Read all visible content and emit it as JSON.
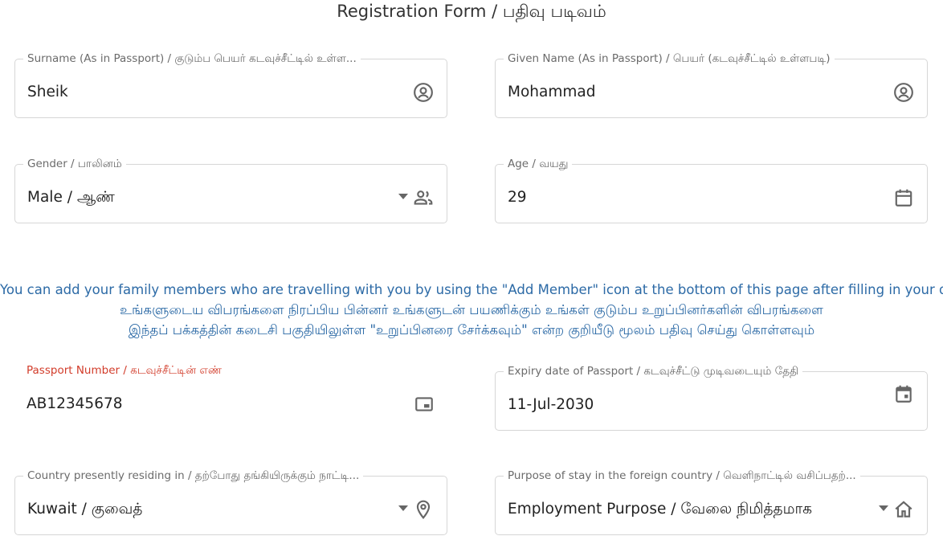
{
  "form": {
    "title": "Registration Form / பதிவு படிவம்"
  },
  "fields": {
    "surname": {
      "label": "Surname (As in Passport) / குடும்ப பெயர் கடவுச்சீட்டில் உள்ள...",
      "value": "Sheik",
      "icon": "account-circle-icon"
    },
    "given_name": {
      "label": "Given Name (As in Passport) / பெயர் (கடவுச்சீட்டில் உள்ளபடி)",
      "value": "Mohammad",
      "icon": "account-circle-icon"
    },
    "gender": {
      "label": "Gender / பாலினம்",
      "value": "Male / ஆண்",
      "icon": "people-icon"
    },
    "age": {
      "label": "Age / வயது",
      "value": "29",
      "icon": "calendar-icon"
    },
    "passport_number": {
      "label": "Passport Number / கடவுச்சீட்டின் எண்",
      "value": "AB12345678",
      "icon": "id-card-icon",
      "label_color": "#d23c2a"
    },
    "expiry_date": {
      "label": "Expiry date of Passport / கடவுச்சீட்டு முடிவடையும் தேதி",
      "value": "11-Jul-2030",
      "icon": "event-icon"
    },
    "country": {
      "label": "Country presently residing in / தற்போது தங்கியிருக்கும் நாட்டி...",
      "value": "Kuwait / குவைத்",
      "icon": "location-pin-icon"
    },
    "purpose": {
      "label": "Purpose of stay in the foreign country / வெளிநாட்டில் வசிப்பதற்...",
      "value": "Employment Purpose / வேலை நிமித்தமாக",
      "icon": "home-icon"
    }
  },
  "notice": {
    "line1": "You can add your family members who are travelling with you by using the \"Add Member\" icon at the bottom of this page after filling in your details.",
    "line2": "உங்களுடைய விபரங்களை நிரப்பிய பின்னர் உங்களுடன் பயணிக்கும் உங்கள் குடும்ப உறுப்பினர்களின் விபரங்களை",
    "line3": "இந்தப் பக்கத்தின் கடைசி பகுதியிலுள்ள \"உறுப்பினரை சேர்க்கவும்\" என்ற குறியீடு மூலம் பதிவு செய்து கொள்ளவும்"
  },
  "colors": {
    "notice_text": "#2c6aa6",
    "error_label": "#d23c2a",
    "field_border": "#d6d6d6",
    "icon": "#666666"
  }
}
